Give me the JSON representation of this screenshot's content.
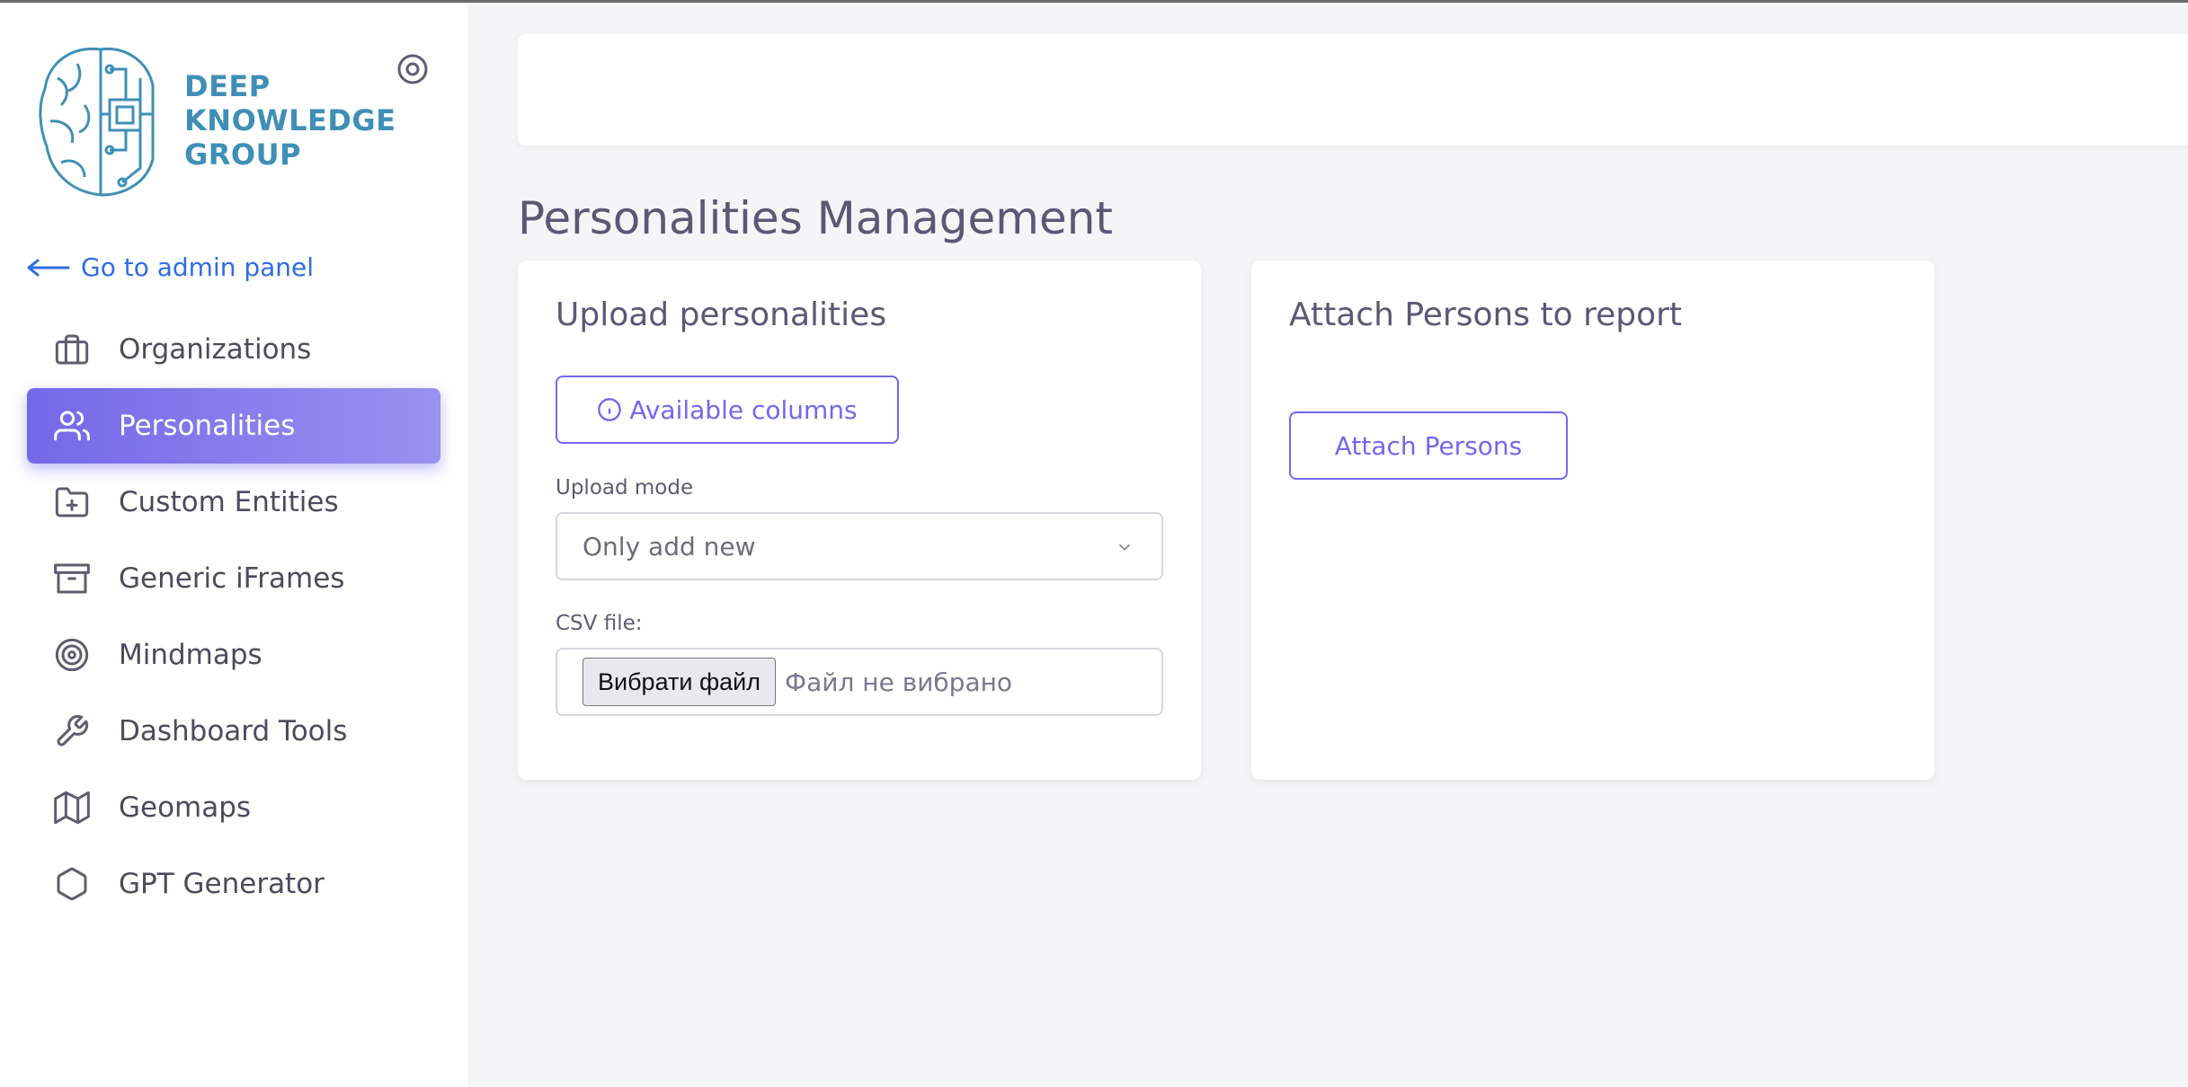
{
  "brand": {
    "line1": "DEEP",
    "line2": "KNOWLEDGE",
    "line3": "GROUP"
  },
  "sidebar": {
    "back_link": "Go to admin panel",
    "items": [
      {
        "label": "Organizations",
        "icon": "briefcase-icon",
        "active": false
      },
      {
        "label": "Personalities",
        "icon": "users-icon",
        "active": true
      },
      {
        "label": "Custom Entities",
        "icon": "folder-plus-icon",
        "active": false
      },
      {
        "label": "Generic iFrames",
        "icon": "archive-icon",
        "active": false
      },
      {
        "label": "Mindmaps",
        "icon": "target-icon",
        "active": false
      },
      {
        "label": "Dashboard Tools",
        "icon": "wrench-icon",
        "active": false
      },
      {
        "label": "Geomaps",
        "icon": "map-icon",
        "active": false
      },
      {
        "label": "GPT Generator",
        "icon": "hexagon-icon",
        "active": false
      }
    ]
  },
  "page": {
    "title": "Personalities Management"
  },
  "upload_card": {
    "title": "Upload personalities",
    "columns_button": "Available columns",
    "mode_label": "Upload mode",
    "mode_value": "Only add new",
    "csv_label": "CSV file:",
    "file_button": "Вибрати файл",
    "file_status": "Файл не вибрано"
  },
  "attach_card": {
    "title": "Attach Persons to report",
    "button": "Attach Persons"
  },
  "colors": {
    "accent": "#7367f0",
    "link": "#2f6de1",
    "text": "#5a5874",
    "logo": "#3f8fb6"
  }
}
